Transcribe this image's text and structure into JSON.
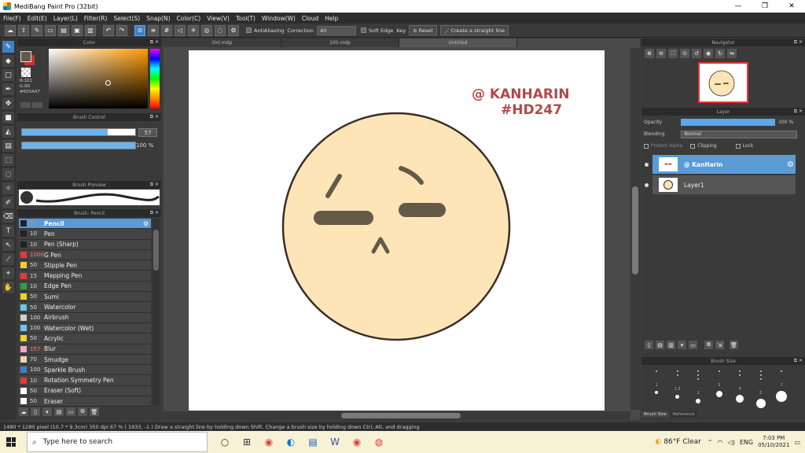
{
  "window": {
    "title": "MediBang Paint Pro (32bit)",
    "controls": [
      "—",
      "❐",
      "✕"
    ]
  },
  "menu": [
    "File(F)",
    "Edit(E)",
    "Layer(L)",
    "Filter(R)",
    "Select(S)",
    "Snap(N)",
    "Color(C)",
    "View(V)",
    "Tool(T)",
    "Window(W)",
    "Cloud",
    "Help"
  ],
  "toolbar": {
    "antialiasing_label": "AntiAliasing",
    "correction_label": "Correction",
    "correction_value": "40",
    "soft_edge_label": "Soft Edge",
    "key_label": "Key",
    "reset_label": "Reset",
    "straight_line_label": "Create a straight line"
  },
  "color_panel": {
    "title": "Color",
    "rgb": "R:101\nG:90\n#655A47",
    "fg_color": "#655a47",
    "bg_color": "#cc3333"
  },
  "brush_control": {
    "title": "Brush Control",
    "size_value": "57",
    "size_fraction": 0.76,
    "opacity_value": "100 %",
    "opacity_fraction": 1.0
  },
  "brush_preview": {
    "title": "Brush Preview"
  },
  "brush_list": {
    "title": "Brush: Pencil",
    "items": [
      {
        "size": "57",
        "name": "Pencil",
        "color": "#222222",
        "selected": true,
        "red": true
      },
      {
        "size": "10",
        "name": "Pen",
        "color": "#222222"
      },
      {
        "size": "10",
        "name": "Pen (Sharp)",
        "color": "#222222"
      },
      {
        "size": "1000",
        "name": "G Pen",
        "color": "#e53935",
        "red": true
      },
      {
        "size": "50",
        "name": "Stipple Pen",
        "color": "#f2d22e"
      },
      {
        "size": "15",
        "name": "Mapping Pen",
        "color": "#e53935"
      },
      {
        "size": "10",
        "name": "Edge Pen",
        "color": "#2ea043"
      },
      {
        "size": "50",
        "name": "Sumi",
        "color": "#f2d22e"
      },
      {
        "size": "50",
        "name": "Watercolor",
        "color": "#6ec6f0"
      },
      {
        "size": "100",
        "name": "Airbrush",
        "color": "#cfcfcf"
      },
      {
        "size": "100",
        "name": "Watercolor (Wet)",
        "color": "#6ec6f0"
      },
      {
        "size": "50",
        "name": "Acrylic",
        "color": "#f2d22e"
      },
      {
        "size": "157",
        "name": "Blur",
        "color": "#f4a6c8",
        "red": true
      },
      {
        "size": "70",
        "name": "Smudge",
        "color": "#f0d6b0"
      },
      {
        "size": "100",
        "name": "Sparkle Brush",
        "color": "#3d80c8"
      },
      {
        "size": "10",
        "name": "Rotation Symmetry Pen",
        "color": "#e53935"
      },
      {
        "size": "50",
        "name": "Eraser (Soft)",
        "color": "#ffffff"
      },
      {
        "size": "50",
        "name": "Eraser",
        "color": "#ffffff"
      }
    ]
  },
  "doc_tabs": [
    "Onl.mdp",
    "100.mdp",
    "Untitled"
  ],
  "canvas": {
    "watermark_line1": "@ KANHARIN",
    "watermark_line2": "#HD247",
    "watermark_color": "#b04a4a",
    "face_color": "#fde5b8",
    "feature_color": "#655a47"
  },
  "navigator": {
    "title": "Navigator"
  },
  "layer_panel": {
    "title": "Layer",
    "opacity_label": "Opacity",
    "opacity_value": "100 %",
    "blending_label": "Blending",
    "blending_value": "Normal",
    "protect_alpha_label": "Protect Alpha",
    "clipping_label": "Clipping",
    "lock_label": "Lock",
    "layers": [
      {
        "name": "@ KanHarin",
        "selected": true
      },
      {
        "name": "Layer1",
        "selected": false
      }
    ]
  },
  "brush_size_panel": {
    "title": "Brush Size",
    "labels": [
      "1",
      "1.5",
      "2",
      "3",
      "4",
      "5",
      "7"
    ],
    "tabs": [
      "Brush Size",
      "Reference"
    ]
  },
  "statusbar": {
    "text": "1480 * 1280 pixel  (10.7 * 9.3cm)  350 dpi  67 %  ( 1933, -1 )  Draw a straight line by holding down Shift. Change a brush size by holding down Ctrl, Alt, and dragging"
  },
  "taskbar": {
    "search_placeholder": "Type here to search",
    "weather": "86°F  Clear",
    "lang": "ENG",
    "time": "7:03 PM",
    "date": "05/10/2021"
  }
}
